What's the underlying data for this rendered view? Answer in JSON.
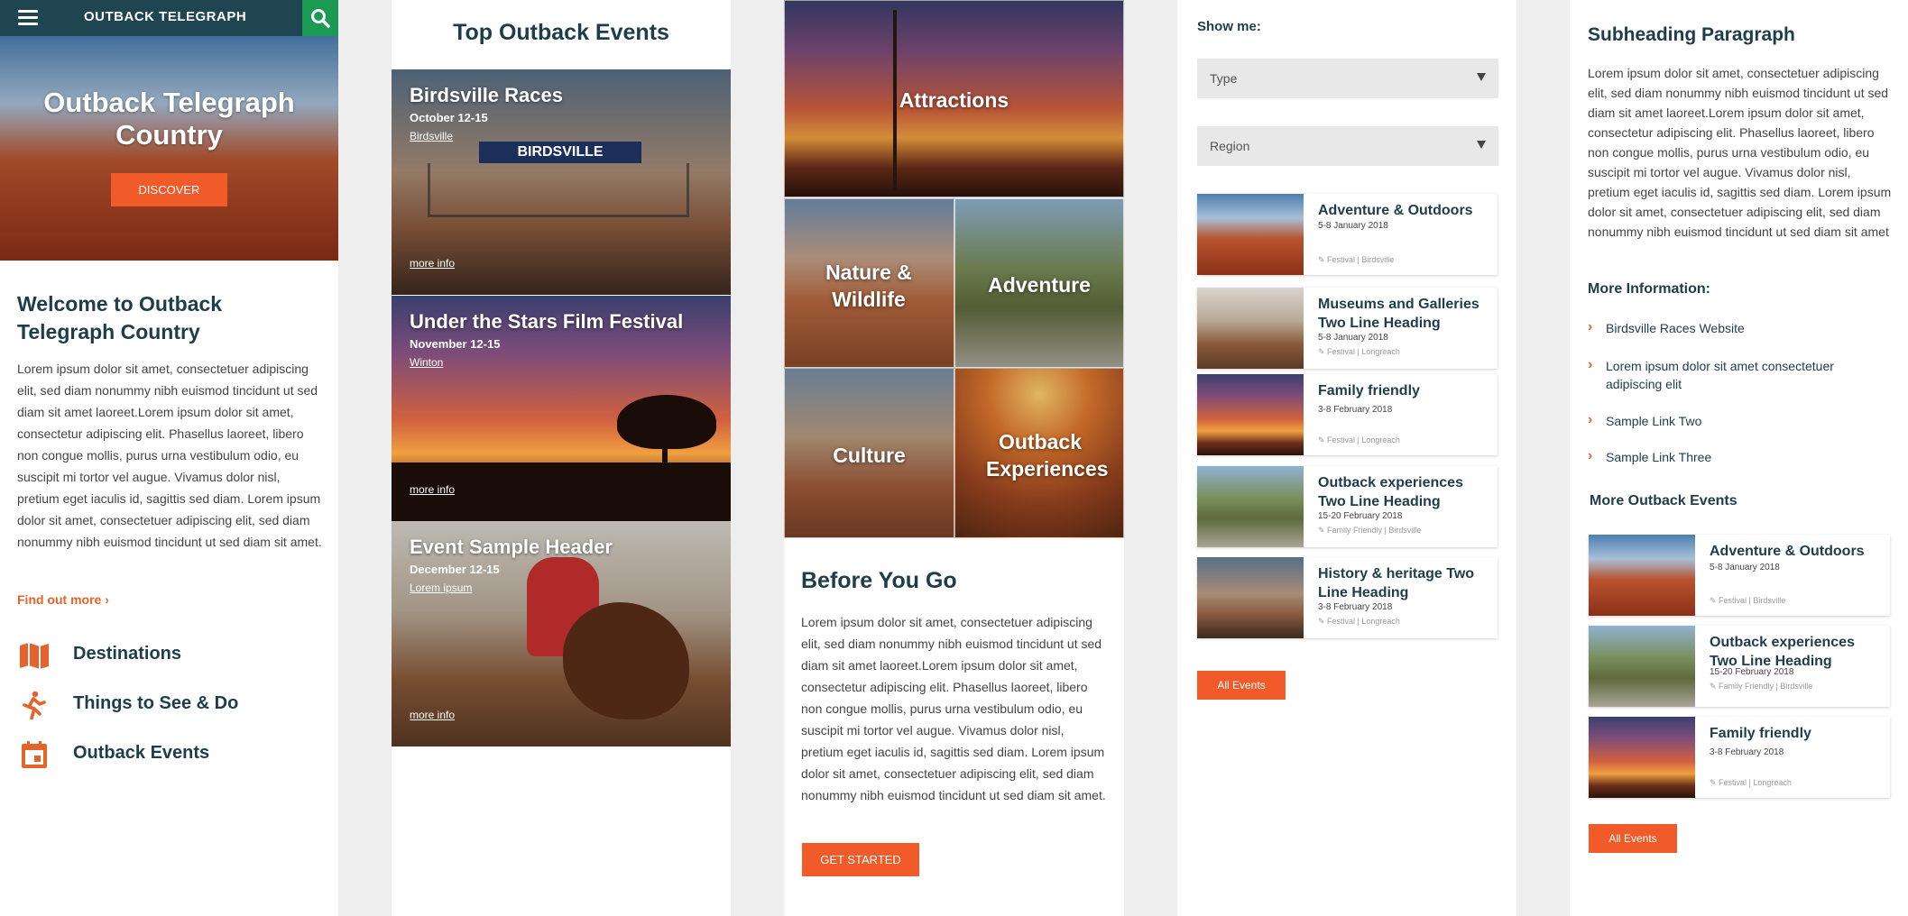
{
  "panel1": {
    "logo": "OUTBACK TELEGRAPH",
    "hero_title": "Outback Telegraph Country",
    "discover_label": "DISCOVER",
    "welcome_title": "Welcome to Outback Telegraph Country",
    "welcome_body": "Lorem ipsum dolor sit amet, consectetuer adipiscing elit, sed diam nonummy nibh euismod tincidunt ut sed diam sit amet laoreet.Lorem ipsum dolor sit amet, consectetur adipiscing elit. Phasellus laoreet, libero non congue mollis, purus urna vestibulum odio, eu suscipit mi tortor vel augue. Vivamus dolor nisl, pretium eget iaculis id, sagittis sed diam. Lorem ipsum dolor sit amet, consectetuer adipiscing elit, sed diam nonummy nibh euismod tincidunt ut sed diam sit amet.",
    "find_out_more": "Find out more",
    "nav": [
      {
        "label": "Destinations",
        "icon": "map-icon"
      },
      {
        "label": "Things to See & Do",
        "icon": "running-person-icon"
      },
      {
        "label": "Outback Events",
        "icon": "calendar-icon"
      }
    ]
  },
  "panel2": {
    "title": "Top Outback Events",
    "events": [
      {
        "title": "Birdsville Races",
        "date": "October 12-15",
        "location": "Birdsville",
        "more": "more info",
        "sign": "BIRDSVILLE"
      },
      {
        "title": "Under the Stars Film Festival",
        "date": "November 12-15",
        "location": "Winton",
        "more": "more info"
      },
      {
        "title": "Event Sample Header",
        "date": "December 12-15",
        "location": "Lorem ipsum",
        "more": "more info"
      }
    ]
  },
  "panel3": {
    "tiles": {
      "attractions": "Attractions",
      "nature": "Nature & Wildlife",
      "adventure": "Adventure",
      "culture": "Culture",
      "outback": "Outback Experiences"
    },
    "before_title": "Before You Go",
    "before_body": "Lorem ipsum dolor sit amet, consectetuer adipiscing elit, sed diam nonummy nibh euismod tincidunt ut sed diam sit amet laoreet.Lorem ipsum dolor sit amet, consectetur adipiscing elit. Phasellus laoreet, libero non congue mollis, purus urna vestibulum odio, eu suscipit mi tortor vel augue. Vivamus dolor nisl, pretium eget iaculis id, sagittis sed diam. Lorem ipsum dolor sit amet, consectetuer adipiscing elit, sed diam nonummy nibh euismod tincidunt ut sed diam sit amet.",
    "get_started": "GET STARTED"
  },
  "panel4": {
    "show_me": "Show me:",
    "type_select": "Type",
    "region_select": "Region",
    "events": [
      {
        "title": "Adventure & Outdoors",
        "date": "5-8 January 2018",
        "tags": "Festival | Birdsville"
      },
      {
        "title": "Museums and Galleries Two Line Heading",
        "date": "5-8 January 2018",
        "tags": "Festival | Longreach"
      },
      {
        "title": "Family friendly",
        "date": "3-8 February 2018",
        "tags": "Festival | Longreach"
      },
      {
        "title": "Outback experiences Two Line Heading",
        "date": "15-20 February 2018",
        "tags": "Family Friendly | Birdsville"
      },
      {
        "title": "History & heritage Two Line Heading",
        "date": "3-8 February 2018",
        "tags": "Festival | Longreach"
      }
    ],
    "all_events": "All Events"
  },
  "panel5": {
    "subheading": "Subheading Paragraph",
    "sub_body": "Lorem ipsum dolor sit amet, consectetuer adipiscing elit, sed diam nonummy nibh euismod tincidunt ut sed diam sit amet laoreet.Lorem ipsum dolor sit amet, consectetur adipiscing elit. Phasellus laoreet, libero non congue mollis, purus urna vestibulum odio, eu suscipit mi tortor vel augue. Vivamus dolor nisl, pretium eget iaculis id, sagittis sed diam.  Lorem ipsum dolor sit amet, consectetuer adipiscing elit, sed diam nonummy nibh euismod tincidunt ut sed diam sit amet",
    "more_info_title": "More Information:",
    "links": [
      "Birdsville Races Website",
      "Lorem ipsum dolor sit amet consectetuer adipiscing elit",
      "Sample Link Two",
      "Sample Link Three"
    ],
    "more_events_title": "More Outback Events",
    "events": [
      {
        "title": "Adventure & Outdoors",
        "date": "5-8 January 2018",
        "tags": "Festival | Birdsville"
      },
      {
        "title": "Outback experiences Two Line Heading",
        "date": "15-20 February 2018",
        "tags": "Family Friendly | Birdsville"
      },
      {
        "title": "Family friendly",
        "date": "3-8 February 2018",
        "tags": "Festival | Longreach"
      }
    ],
    "all_events": "All Events"
  },
  "colors": {
    "accent": "#f15a29",
    "heading": "#1e3d4a",
    "topbar": "#1e4550",
    "search": "#1b9a54"
  }
}
